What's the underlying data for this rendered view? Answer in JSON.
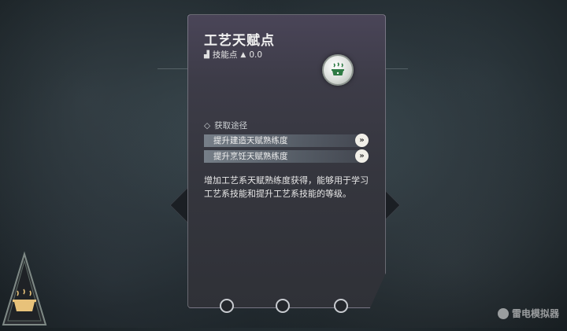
{
  "card": {
    "title": "工艺天赋点",
    "points_label": "技能点",
    "points_value": "0.0",
    "emblem_icon": "cooking-pot-icon"
  },
  "sources": {
    "header": "获取途径",
    "items": [
      {
        "label": "提升建造天赋熟练度"
      },
      {
        "label": "提升烹饪天赋熟练度"
      }
    ]
  },
  "description": "增加工艺系天赋熟练度获得，能够用于学习工艺系技能和提升工艺系技能的等级。",
  "watermark": "雷电模拟器"
}
